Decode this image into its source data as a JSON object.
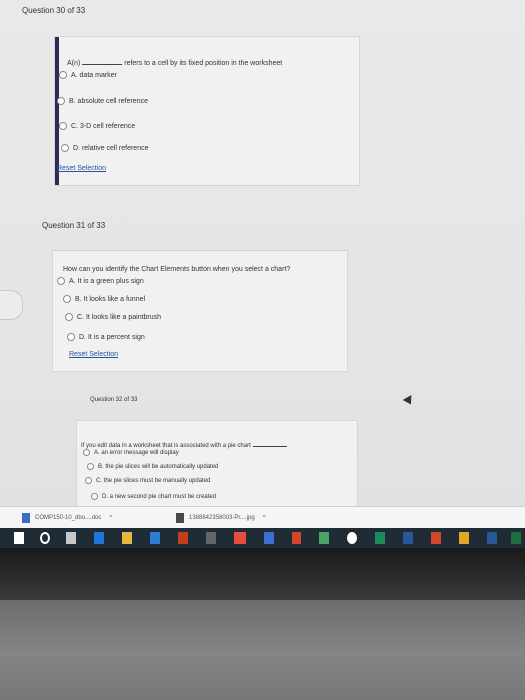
{
  "questions": [
    {
      "header": "Question 30 of 33",
      "prompt_prefix": "A(n)",
      "prompt_rest": "refers to a cell by its fixed position in the worksheet",
      "options": [
        "A. data marker",
        "B. absolute cell reference",
        "C. 3-D cell reference",
        "D. relative cell reference"
      ],
      "reset": "Reset Selection"
    },
    {
      "header": "Question 31 of 33",
      "prompt": "How can you identify the Chart Elements button when you select a chart?",
      "options": [
        "A. It is a green plus sign",
        "B. It looks like a funnel",
        "C. It looks like a paintbrush",
        "D. It is a percent sign"
      ],
      "reset": "Reset Selection"
    },
    {
      "header": "Question 32 of 33",
      "prompt": "If you edit data in a worksheet that is associated with a pie chart",
      "options": [
        "A. an error message will display",
        "B. the pie slices will be automatically updated",
        "C. the pie slices must be manually updated",
        "D. a new second pie chart must be created"
      ]
    }
  ],
  "downloads": [
    {
      "name": "COMP150-10_dbo....doc"
    },
    {
      "name": "1388842358003-Pr....jpg"
    }
  ],
  "colors": {
    "accent_bar": "#2c2c57",
    "link": "#2a4fa0",
    "taskbar": "#1f2b35"
  }
}
